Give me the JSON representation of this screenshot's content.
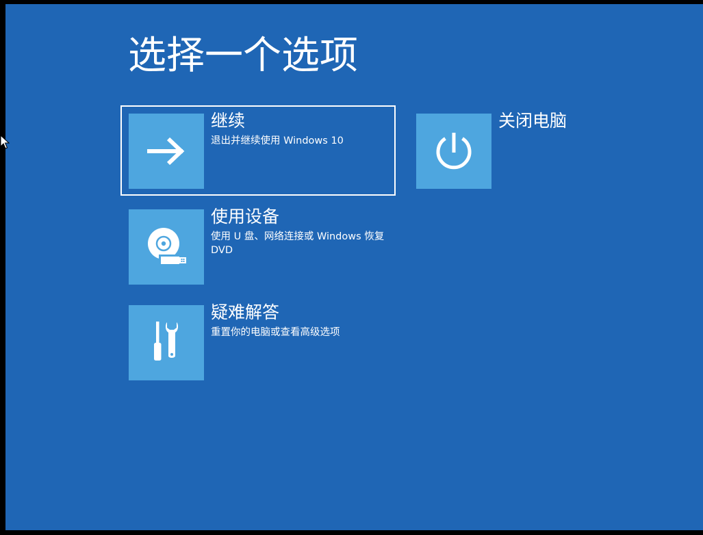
{
  "screen": {
    "title": "选择一个选项",
    "colors": {
      "background": "#1f66b5",
      "tile": "#4ea6df",
      "focus_border": "#ffffff",
      "text": "#ffffff"
    }
  },
  "options": [
    {
      "title": "继续",
      "description": "退出并继续使用 Windows 10",
      "icon": "arrow-right-icon",
      "focused": true
    },
    {
      "title": "关闭电脑",
      "description": "",
      "icon": "power-icon",
      "focused": false
    },
    {
      "title": "使用设备",
      "description": "使用 U 盘、网络连接或 Windows 恢复 DVD",
      "icon": "disc-usb-icon",
      "focused": false
    },
    {
      "title": "疑难解答",
      "description": "重置你的电脑或查看高级选项",
      "icon": "tools-icon",
      "focused": false
    }
  ]
}
